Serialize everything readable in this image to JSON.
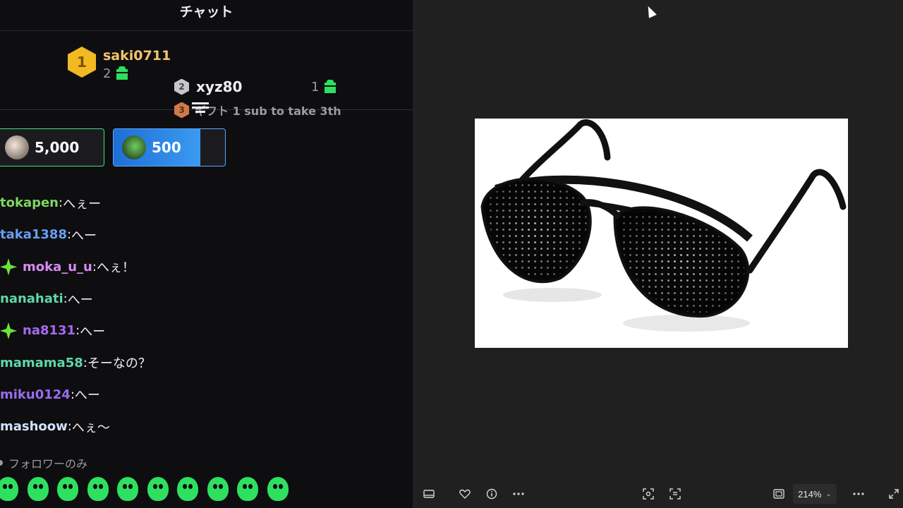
{
  "chat": {
    "title": "チャット",
    "leaderboard": {
      "first": {
        "rank": "1",
        "name": "saki0711",
        "count": "2"
      },
      "second": {
        "rank": "2",
        "name": "xyz80",
        "count": "1"
      },
      "third": {
        "rank": "3",
        "text": "ギフト 1 sub to take 3th"
      }
    },
    "pills": [
      {
        "value": "5,000"
      },
      {
        "value": "500"
      }
    ],
    "messages": [
      {
        "user": "tokapen",
        "text": "へぇー",
        "color": "#7dd862",
        "badge": false
      },
      {
        "user": "taka1388",
        "text": "へー",
        "color": "#6a9df2",
        "badge": false
      },
      {
        "user": "moka_u_u",
        "text": "へぇ！",
        "color": "#d98bf2",
        "badge": true
      },
      {
        "user": "nanahati",
        "text": "へー",
        "color": "#5ed8a9",
        "badge": false
      },
      {
        "user": "na8131",
        "text": "へー",
        "color": "#a66af2",
        "badge": true
      },
      {
        "user": "mamama58",
        "text": "そーなの？",
        "color": "#5ed8a9",
        "badge": false
      },
      {
        "user": "miku0124",
        "text": "へー",
        "color": "#9b6af2",
        "badge": false
      },
      {
        "user": "mashoow",
        "text": "へぇ〜",
        "color": "#cfe4ff",
        "badge": false
      }
    ],
    "followers_only": "フォロワーのみ",
    "emote_icons": [
      "frog-emote-icon",
      "frog-emote-icon",
      "frog-emote-icon",
      "frog-emote-icon",
      "frog-emote-icon",
      "frog-emote-icon",
      "frog-emote-icon",
      "frog-emote-icon",
      "frog-emote-icon",
      "frog-emote-icon"
    ]
  },
  "viewer": {
    "image_subject": "sunglasses-image",
    "zoom": "214%"
  },
  "colors": {
    "accent_green": "#2ee05f",
    "gold": "#f2b922",
    "blue": "#3a9bf0"
  }
}
